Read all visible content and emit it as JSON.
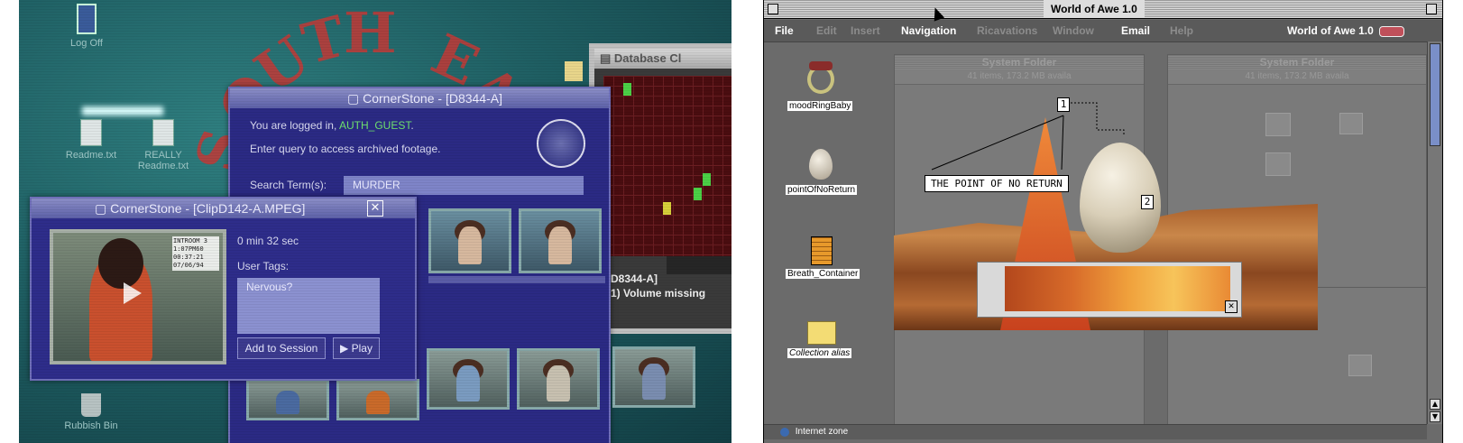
{
  "left": {
    "desktop_icons": {
      "log_off": "Log Off",
      "readme": "Readme.txt",
      "really_readme_1": "REALLY",
      "really_readme_2": "Readme.txt",
      "rubbish_bin": "Rubbish Bin"
    },
    "arc_letters": [
      "S",
      "O",
      "U",
      "T",
      "H",
      "E",
      "A"
    ],
    "main_window": {
      "title": "CornerStone - [D8344-A]",
      "logged_in_prefix": "You are logged in, ",
      "user": "AUTH_GUEST",
      "logged_in_suffix": ".",
      "instruction": "Enter query to access archived footage.",
      "search_label": "Search Term(s):",
      "search_value": "MURDER"
    },
    "clip_window": {
      "title": "CornerStone - [ClipD142-A.MPEG]",
      "duration": "0 min 32 sec",
      "user_tags_label": "User Tags:",
      "user_tags_value": "Nervous?",
      "add_button": "Add to Session",
      "play_button": "▶ Play",
      "video_overlay_1": "INTROOM 3",
      "video_overlay_2": "1:07PM60",
      "video_overlay_3": "00:37:21",
      "video_overlay_4": "07/06/94"
    },
    "database_window": {
      "title": "Database Cl",
      "id": "[D8344-A]",
      "status": "(1) Volume missing"
    },
    "colors": {
      "tag_green": "#6fe36f",
      "accent_red": "#c23a37"
    }
  },
  "right": {
    "window_title": "World of Awe 1.0",
    "menu": {
      "file": "File",
      "edit": "Edit",
      "insert": "Insert",
      "navigation": "Navigation",
      "ricavations": "Ricavations",
      "window": "Window",
      "email": "Email",
      "help": "Help",
      "app_name": "World of Awe 1.0"
    },
    "icons": {
      "mood_ring": "moodRingBaby",
      "point_of_no_return": "pointOfNoReturn",
      "breath_container": "Breath_Container",
      "collection_alias": "Collection alias"
    },
    "system_folder_1": {
      "title": "System Folder",
      "info": "41 items, 173.2 MB availa"
    },
    "system_folder_2": {
      "title": "System Folder",
      "info": "41 items, 173.2 MB availa"
    },
    "callout_text": "THE POINT OF NO RETURN",
    "markers": {
      "one": "1",
      "two": "2"
    },
    "status_bar": "Internet zone"
  }
}
